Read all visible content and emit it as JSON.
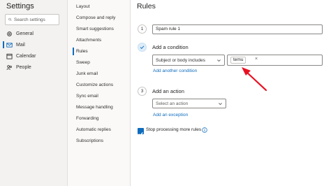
{
  "settings": {
    "title": "Settings",
    "search_placeholder": "Search settings",
    "nav": [
      {
        "label": "General",
        "icon": "gear-icon"
      },
      {
        "label": "Mail",
        "icon": "mail-icon"
      },
      {
        "label": "Calendar",
        "icon": "calendar-icon"
      },
      {
        "label": "People",
        "icon": "people-icon"
      }
    ],
    "selected_nav": "Mail"
  },
  "mail_settings": {
    "items": [
      "Layout",
      "Compose and reply",
      "Smart suggestions",
      "Attachments",
      "Rules",
      "Sweep",
      "Junk email",
      "Customize actions",
      "Sync email",
      "Message handling",
      "Forwarding",
      "Automatic replies",
      "Subscriptions"
    ],
    "selected": "Rules"
  },
  "rules": {
    "title": "Rules",
    "step1": {
      "number": "1",
      "name_value": "Spam rule 1"
    },
    "step2": {
      "label": "Add a condition",
      "condition_value": "Subject or body includes",
      "tag": "temu",
      "tag_close": "×",
      "add_link": "Add another condition"
    },
    "step3": {
      "number": "3",
      "label": "Add an action",
      "action_placeholder": "Select an action",
      "exception_link": "Add an exception"
    },
    "stop_processing": {
      "label": "Stop processing more rules",
      "checked": true
    }
  },
  "colors": {
    "accent": "#0f6cbd",
    "annotation_arrow": "#e81123"
  }
}
